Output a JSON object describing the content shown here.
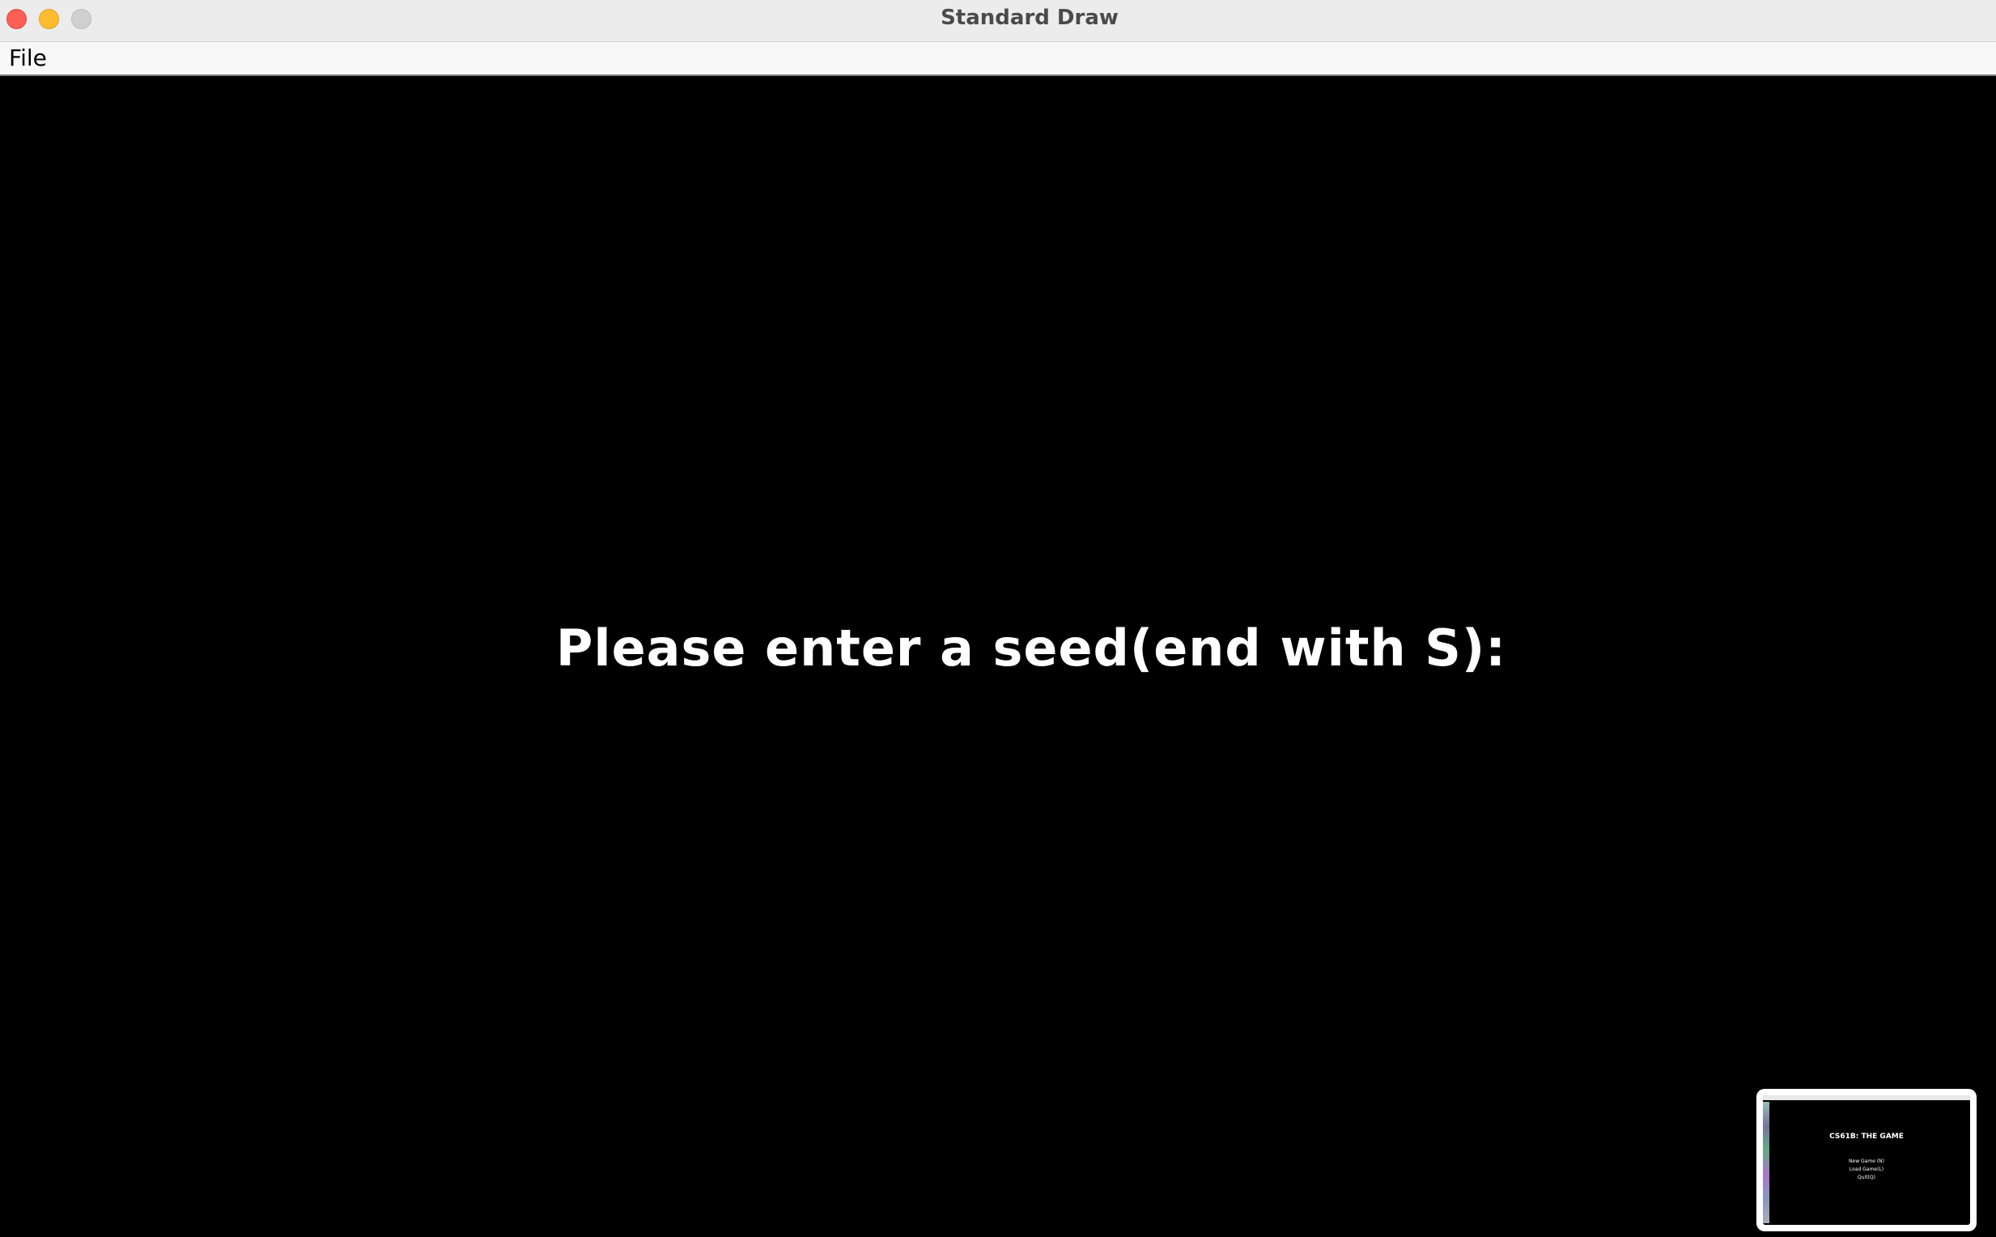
{
  "window": {
    "title": "Standard Draw"
  },
  "menubar": {
    "file_label": "File"
  },
  "canvas": {
    "prompt": "Please enter a seed(end with S):"
  },
  "thumbnail": {
    "title": "CS61B: THE GAME",
    "options": [
      "New Game (N)",
      "Load Game(L)",
      "Quit(Q)"
    ]
  },
  "colors": {
    "canvas_background": "#000000",
    "text": "#ffffff",
    "close_button": "#fe5f57",
    "minimize_button": "#febc2e",
    "zoom_button": "#d0d0d0"
  }
}
